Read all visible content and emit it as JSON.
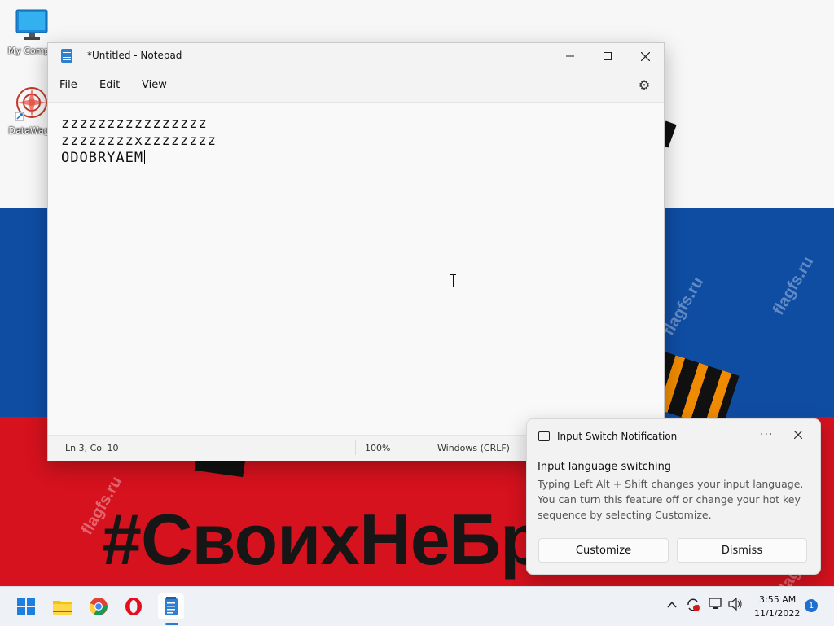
{
  "wallpaper": {
    "hashtag": "#СвоихНеБр",
    "watermark": "flagfs.ru",
    "colors": {
      "white": "#f7f7f8",
      "blue": "#0f4da3",
      "red": "#d5121e"
    }
  },
  "desktop": {
    "icons": [
      {
        "label": "My Compu",
        "icon": "monitor-icon"
      },
      {
        "label": "DataWago",
        "icon": "datawagon-icon"
      }
    ]
  },
  "notepad": {
    "title": "*Untitled - Notepad",
    "menu": [
      "File",
      "Edit",
      "View"
    ],
    "lines": [
      "zzzzzzzzzzzzzzzz",
      "zzzzzzzzxzzzzzzzz",
      "ODOBRYAEM"
    ],
    "status": {
      "position": "Ln 3, Col 10",
      "zoom": "100%",
      "line_ending": "Windows (CRLF)"
    }
  },
  "notification": {
    "app": "Input Switch Notification",
    "heading": "Input language switching",
    "body": "Typing Left Alt + Shift changes your input language. You can turn this feature off or change your hot key sequence by selecting Customize.",
    "buttons": {
      "customize": "Customize",
      "dismiss": "Dismiss"
    }
  },
  "taskbar": {
    "apps": [
      "start-icon",
      "file-explorer-icon",
      "chrome-icon",
      "opera-icon",
      "notepad-icon"
    ],
    "clock": {
      "time": "3:55 AM",
      "date": "11/1/2022"
    },
    "notification_count": "1"
  }
}
